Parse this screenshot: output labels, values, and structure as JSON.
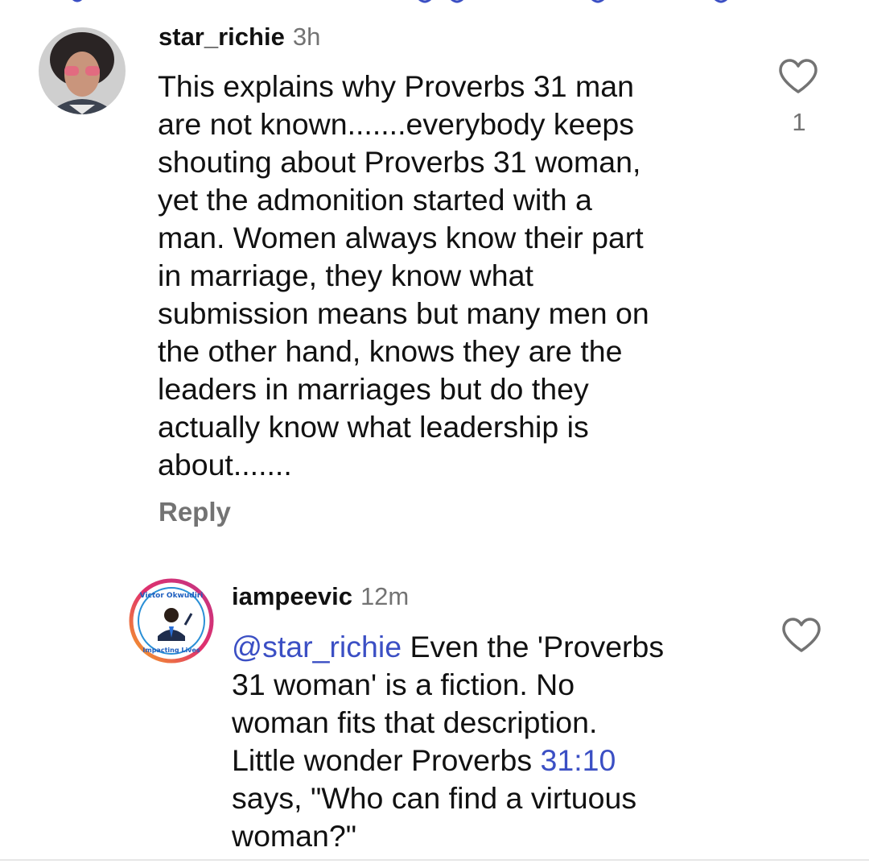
{
  "colors": {
    "text": "#111111",
    "muted": "#737373",
    "link": "#3b4fc4",
    "ring_start": "#f58529",
    "ring_end": "#dd2a7b"
  },
  "comments": [
    {
      "username": "star_richie",
      "time": "3h",
      "text_lines": [
        "This explains why Proverbs 31 man",
        "are not known.......everybody keeps",
        "shouting about Proverbs 31 woman,",
        "yet the admonition started with a",
        "man. Women always know their part",
        "in marriage, they know what",
        "submission means but many men on",
        "the other hand, knows they are the",
        "leaders in marriages but do they",
        "actually know what leadership is",
        "about......."
      ],
      "reply_label": "Reply",
      "like_icon": "heart-outline-icon",
      "like_count": "1"
    },
    {
      "username": "iampeevic",
      "time": "12m",
      "mention": "@star_richie",
      "text_line1_rest": " Even the 'Proverbs",
      "text_lines_middle": [
        "31 woman' is a fiction. No",
        "woman fits that description."
      ],
      "line4_prefix": "Little wonder Proverbs ",
      "verse_link": "31:10",
      "text_lines_end": [
        "says, \"Who can find a virtuous",
        "woman?\""
      ],
      "like_icon": "heart-outline-icon",
      "avatar_ring_text_top": "Victor Okwudiri",
      "avatar_ring_text_bottom": "Impacting Lives"
    }
  ]
}
